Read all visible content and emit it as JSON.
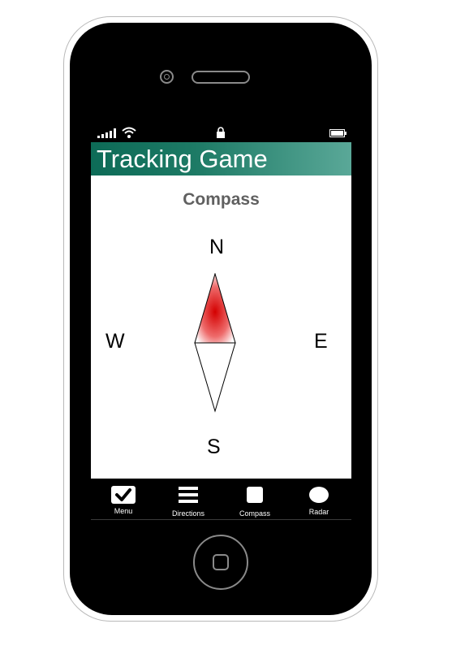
{
  "app": {
    "title": "Tracking Game"
  },
  "page": {
    "title": "Compass"
  },
  "compass": {
    "north": "N",
    "south": "S",
    "east": "E",
    "west": "W",
    "needle_color": "#d90000"
  },
  "tabs": [
    {
      "label": "Menu",
      "icon": "check-icon"
    },
    {
      "label": "Directions",
      "icon": "list-icon"
    },
    {
      "label": "Compass",
      "icon": "square-icon"
    },
    {
      "label": "Radar",
      "icon": "circle-icon"
    }
  ],
  "colors": {
    "titlebar_start": "#0d6b57",
    "titlebar_end": "#5aa898"
  }
}
